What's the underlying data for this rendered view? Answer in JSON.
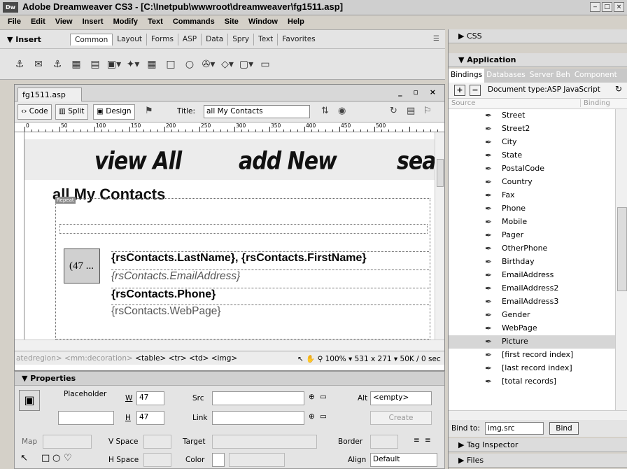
{
  "window": {
    "app_icon": "Dw",
    "title": "Adobe Dreamweaver CS3 - [C:\\Inetpub\\wwwroot\\dreamweaver\\fg1511.asp]",
    "buttons": [
      "min",
      "max",
      "close"
    ]
  },
  "menu": [
    "File",
    "Edit",
    "View",
    "Insert",
    "Modify",
    "Text",
    "Commands",
    "Site",
    "Window",
    "Help"
  ],
  "insert_panel": {
    "label": "▼ Insert",
    "tabs": [
      "Common",
      "Layout",
      "Forms",
      "ASP",
      "Data",
      "Spry",
      "Text",
      "Favorites"
    ],
    "active_tab": "Common",
    "icons": [
      "hyperlink-icon",
      "email-icon",
      "anchor-icon",
      "table-icon",
      "div-icon",
      "image-icon",
      "media-icon",
      "date-icon",
      "comment-icon",
      "head-icon",
      "script-icon",
      "template-icon",
      "tag-chooser-icon",
      "snippet-icon"
    ]
  },
  "document": {
    "tab": "fg1511.asp",
    "window_ctrls": "_ ▫ ×",
    "view_buttons": {
      "code": "Code",
      "split": "Split",
      "design": "Design"
    },
    "title_label": "Title:",
    "title_value": "all My Contacts",
    "ruler_labels": [
      "0",
      "50",
      "100",
      "150",
      "200",
      "250",
      "300",
      "350",
      "400",
      "450",
      "500"
    ],
    "banner_words": [
      "view All",
      "add New",
      "sea"
    ],
    "heading": "all My Contacts",
    "repeat_tag": "Repeat",
    "placeholder_text": "(47 ...",
    "bindings": {
      "name": "{rsContacts.LastName}, {rsContacts.FirstName}",
      "email": "{rsContacts.EmailAddress}",
      "phone": "{rsContacts.Phone}",
      "web": "{rsContacts.WebPage}"
    },
    "tag_selector": {
      "dim": "atedregion> <mm:decoration>",
      "tags": "<table> <tr> <td> <img>"
    },
    "zoom": "100%",
    "size": "531 x 271",
    "download": "50K / 0 sec"
  },
  "properties": {
    "header": "▼ Properties",
    "placeholder_label": "Placeholder",
    "w_label": "W",
    "w_value": "47",
    "h_label": "H",
    "h_value": "47",
    "src_label": "Src",
    "link_label": "Link",
    "alt_label": "Alt",
    "alt_value": "<empty>",
    "create_label": "Create",
    "map_label": "Map",
    "vspace_label": "V Space",
    "target_label": "Target",
    "border_label": "Border",
    "hspace_label": "H Space",
    "color_label": "Color",
    "align_label": "Align",
    "align_value": "Default"
  },
  "right_panels": {
    "css": "▶ CSS",
    "application": "▼ Application",
    "app_tabs": [
      "Bindings",
      "Databases",
      "Server Beh",
      "Component"
    ],
    "doc_type": "Document type:ASP JavaScript",
    "col_source": "Source",
    "col_binding": "Binding",
    "bindings": [
      "Street",
      "Street2",
      "City",
      "State",
      "PostalCode",
      "Country",
      "Fax",
      "Phone",
      "Mobile",
      "Pager",
      "OtherPhone",
      "Birthday",
      "EmailAddress",
      "EmailAddress2",
      "EmailAddress3",
      "Gender",
      "WebPage",
      "Picture",
      "[first record index]",
      "[last record index]",
      "[total records]"
    ],
    "selected_binding": "Picture",
    "bind_to_label": "Bind to:",
    "bind_to_value": "img.src",
    "bind_button": "Bind",
    "tag_inspector": "▶ Tag Inspector",
    "files": "▶ Files"
  }
}
